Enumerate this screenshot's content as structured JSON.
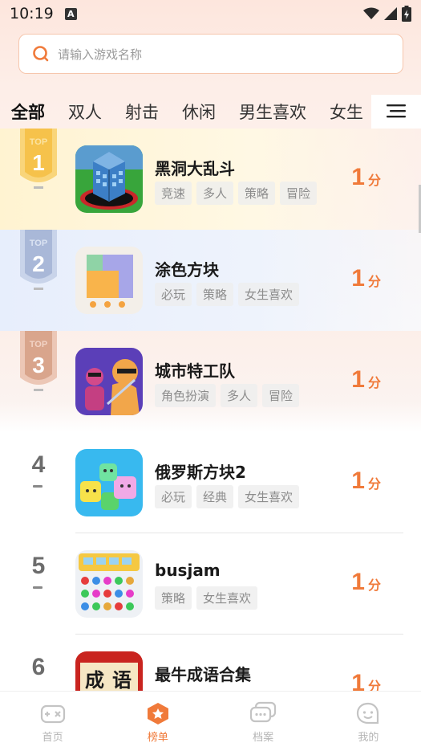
{
  "status": {
    "time": "10:19",
    "a_icon_letter": "A"
  },
  "search": {
    "placeholder": "请输入游戏名称"
  },
  "tabs": [
    "全部",
    "双人",
    "射击",
    "休闲",
    "男生喜欢",
    "女生"
  ],
  "active_tab": 0,
  "medal_text": "TOP",
  "games": [
    {
      "rank": "1",
      "title": "黑洞大乱斗",
      "tags": [
        "竞速",
        "多人",
        "策略",
        "冒险"
      ],
      "score": "1",
      "score_unit": "分"
    },
    {
      "rank": "2",
      "title": "涂色方块",
      "tags": [
        "必玩",
        "策略",
        "女生喜欢"
      ],
      "score": "1",
      "score_unit": "分"
    },
    {
      "rank": "3",
      "title": "城市特工队",
      "tags": [
        "角色扮演",
        "多人",
        "冒险"
      ],
      "score": "1",
      "score_unit": "分"
    },
    {
      "rank": "4",
      "title": "俄罗斯方块2",
      "tags": [
        "必玩",
        "经典",
        "女生喜欢"
      ],
      "score": "1",
      "score_unit": "分"
    },
    {
      "rank": "5",
      "title": "busjam",
      "tags": [
        "策略",
        "女生喜欢"
      ],
      "score": "1",
      "score_unit": "分"
    },
    {
      "rank": "6",
      "title": "最牛成语合集",
      "tags": [],
      "score": "1",
      "score_unit": "分",
      "icon_text": [
        "成",
        "语"
      ]
    }
  ],
  "nav": [
    {
      "label": "首页",
      "icon": "gamepad-icon"
    },
    {
      "label": "榜单",
      "icon": "ranking-icon"
    },
    {
      "label": "档案",
      "icon": "chat-bubbles-icon"
    },
    {
      "label": "我的",
      "icon": "smile-bubble-icon"
    }
  ],
  "active_nav": 1,
  "colors": {
    "accent": "#f07a3a",
    "gold": "#f6c24b",
    "silver": "#a9b8d8",
    "bronze": "#d9a58c"
  }
}
